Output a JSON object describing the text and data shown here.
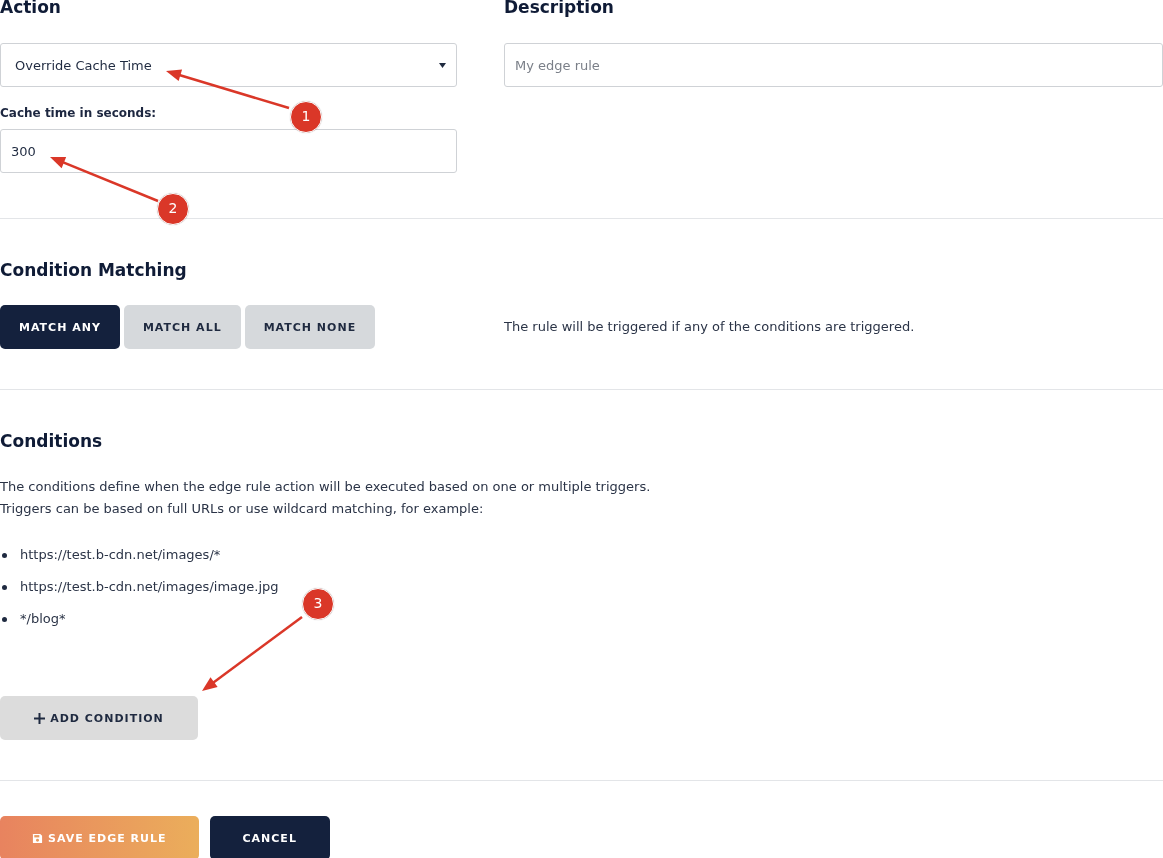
{
  "action": {
    "heading": "Action",
    "select": {
      "value": "Override Cache Time"
    },
    "cache_time": {
      "label": "Cache time in seconds:",
      "value": "300"
    }
  },
  "description": {
    "heading": "Description",
    "input": {
      "placeholder": "My edge rule"
    }
  },
  "condition_matching": {
    "heading": "Condition Matching",
    "options": [
      {
        "label": "MATCH ANY",
        "selected": true
      },
      {
        "label": "MATCH ALL",
        "selected": false
      },
      {
        "label": "MATCH NONE",
        "selected": false
      }
    ],
    "explanation": "The rule will be triggered if any of the conditions are triggered."
  },
  "conditions": {
    "heading": "Conditions",
    "intro": [
      "The conditions define when the edge rule action will be executed based on one or multiple triggers.",
      "Triggers can be based on full URLs or use wildcard matching, for example:"
    ],
    "examples": [
      "https://test.b-cdn.net/images/*",
      "https://test.b-cdn.net/images/image.jpg",
      "*/blog*"
    ],
    "add_button": "ADD CONDITION"
  },
  "footer_buttons": [
    {
      "kind": "primary",
      "label": "SAVE EDGE RULE"
    },
    {
      "kind": "secondary",
      "label": "CANCEL"
    }
  ],
  "callouts": [
    "1",
    "2",
    "3"
  ]
}
